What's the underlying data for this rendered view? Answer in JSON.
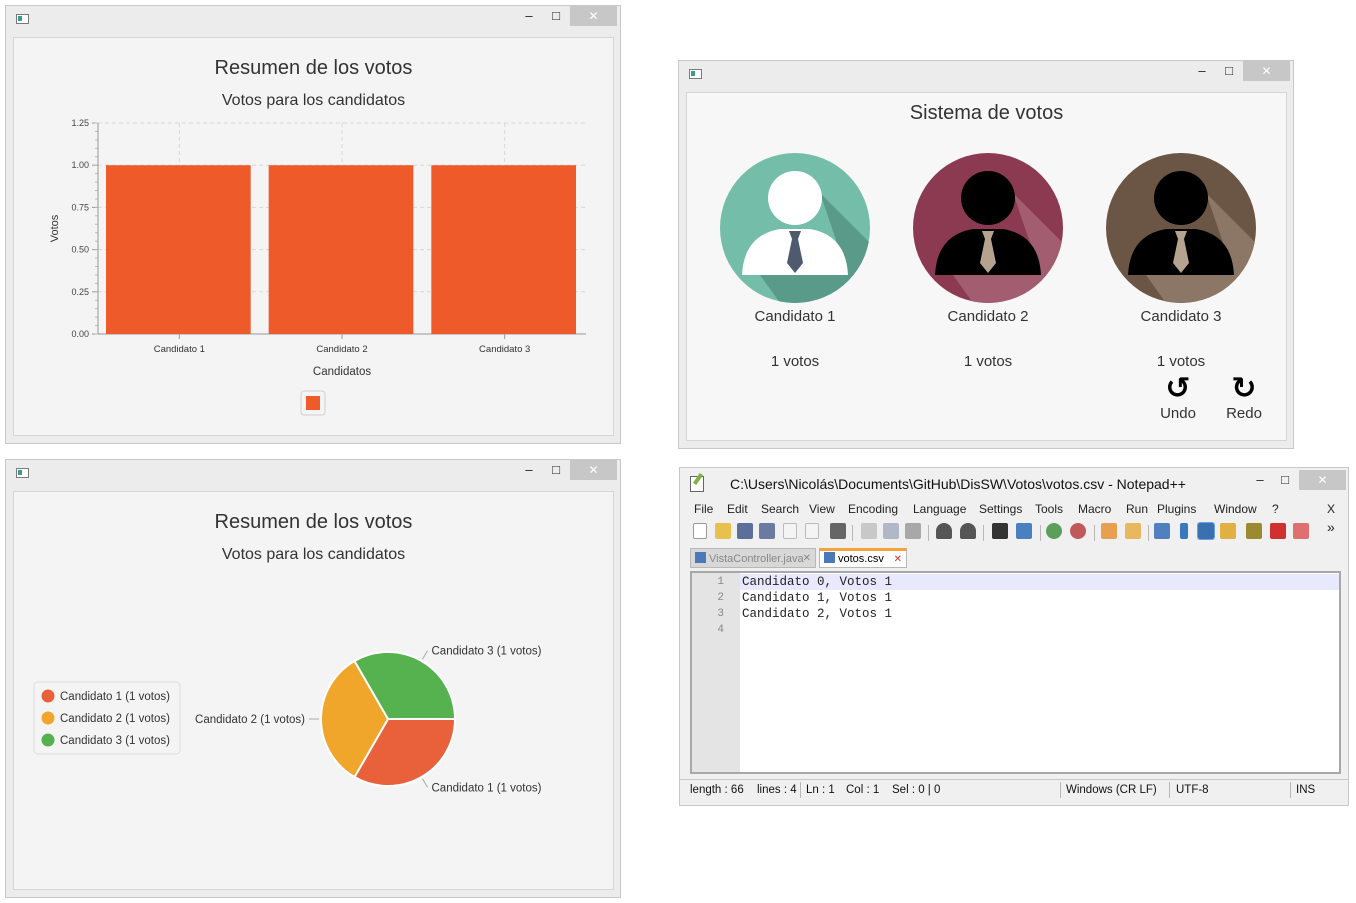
{
  "colors": {
    "bar": "#ef5a2a",
    "candidate1_bg": "#74bea9",
    "candidate2_bg": "#8b3a52",
    "candidate3_bg": "#6b5645",
    "pie1": "#e8613a",
    "pie2": "#f0a52b",
    "pie3": "#55b24f"
  },
  "window_controls": {
    "minimize": "–",
    "maximize": "□",
    "close": "✕"
  },
  "bar_window": {
    "title": "Resumen de los votos",
    "subtitle": "Votos para los candidatos",
    "chart_data": {
      "type": "bar",
      "categories": [
        "Candidato 1",
        "Candidato 2",
        "Candidato 3"
      ],
      "values": [
        1,
        1,
        1
      ],
      "title": "Resumen de los votos",
      "subtitle": "Votos para los candidatos",
      "xlabel": "Candidatos",
      "ylabel": "Votos",
      "ylim": [
        0,
        1.25
      ],
      "yticks": [
        "0.00",
        "0.25",
        "0.50",
        "0.75",
        "1.00",
        "1.25"
      ],
      "grid": true,
      "legend": "bottom"
    }
  },
  "pie_window": {
    "title": "Resumen de los votos",
    "subtitle": "Votos para los candidatos",
    "chart_data": {
      "type": "pie",
      "labels": [
        "Candidato 1 (1 votos)",
        "Candidato 2 (1 votos)",
        "Candidato 3 (1 votos)"
      ],
      "values": [
        1,
        1,
        1
      ],
      "title": "Resumen de los votos",
      "subtitle": "Votos para los candidatos",
      "legend": "left"
    }
  },
  "vote_window": {
    "title": "Sistema de votos",
    "candidates": [
      {
        "name": "Candidato 1",
        "votes": "1 votos"
      },
      {
        "name": "Candidato 2",
        "votes": "1 votos"
      },
      {
        "name": "Candidato 3",
        "votes": "1 votos"
      }
    ],
    "undo_label": "Undo",
    "redo_label": "Redo",
    "undo_icon": "↺",
    "redo_icon": "↻"
  },
  "notepad": {
    "title": "C:\\Users\\Nicolás\\Documents\\GitHub\\DisSW\\Votos\\votos.csv - Notepad++",
    "menu": [
      "File",
      "Edit",
      "Search",
      "View",
      "Encoding",
      "Language",
      "Settings",
      "Tools",
      "Macro",
      "Run",
      "Plugins",
      "Window",
      "?"
    ],
    "menu_close": "X",
    "toolbar_more": "»",
    "tabs": [
      {
        "label": "VistaController.java",
        "active": false
      },
      {
        "label": "votos.csv",
        "active": true
      }
    ],
    "tab_close": "✕",
    "lines": [
      "Candidato 0, Votos 1",
      "Candidato 1, Votos 1",
      "Candidato 2, Votos 1",
      ""
    ],
    "line_numbers": [
      "1",
      "2",
      "3",
      "4"
    ],
    "status": {
      "length": "length : 66",
      "lines": "lines : 4",
      "ln": "Ln : 1",
      "col": "Col : 1",
      "sel": "Sel : 0 | 0",
      "eol": "Windows (CR LF)",
      "encoding": "UTF-8",
      "mode": "INS"
    }
  }
}
